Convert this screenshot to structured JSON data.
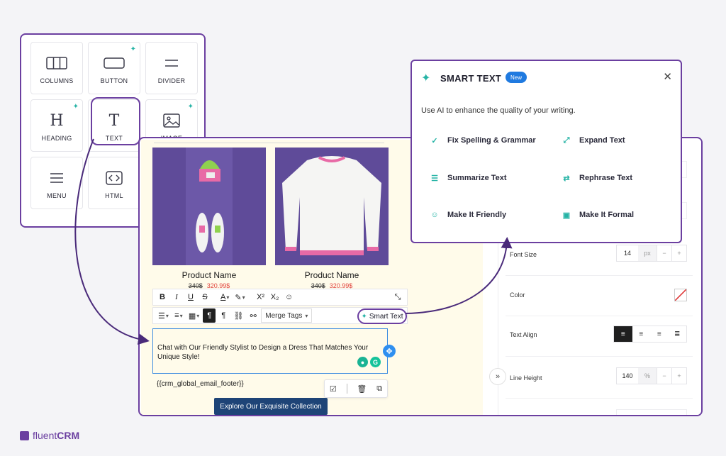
{
  "palette": {
    "tiles": [
      {
        "label": "COLUMNS",
        "icon": "columns-icon",
        "ai": false
      },
      {
        "label": "BUTTON",
        "icon": "button-icon",
        "ai": true
      },
      {
        "label": "DIVIDER",
        "icon": "divider-icon",
        "ai": false
      },
      {
        "label": "HEADING",
        "icon": "heading-icon",
        "ai": true
      },
      {
        "label": "TEXT",
        "icon": "text-icon",
        "ai": false
      },
      {
        "label": "IMAGE",
        "icon": "image-icon",
        "ai": true
      },
      {
        "label": "MENU",
        "icon": "menu-icon",
        "ai": false
      },
      {
        "label": "HTML",
        "icon": "html-icon",
        "ai": false
      }
    ]
  },
  "editor": {
    "products": [
      {
        "name": "Product Name",
        "old_price": "340$",
        "new_price": "320.99$"
      },
      {
        "name": "Product Name",
        "old_price": "340$",
        "new_price": "320.99$"
      }
    ],
    "toolbar": {
      "merge_tags": "Merge Tags",
      "smart_text": "Smart Text"
    },
    "text_content": "Chat with Our Friendly Stylist to Design a Dress That Matches Your Unique Style!",
    "footer_tag": "{{crm_global_email_footer}}",
    "cta": "Explore Our Exquisite Collection"
  },
  "settings": {
    "font_size_label": "Font Size",
    "font_size_value": "14",
    "font_size_unit": "px",
    "color_label": "Color",
    "text_align_label": "Text Align",
    "line_height_label": "Line Height",
    "line_height_value": "140",
    "line_height_unit": "%"
  },
  "smart_text_popup": {
    "title": "SMART TEXT",
    "badge": "New",
    "description": "Use AI to enhance the quality of your writing.",
    "options": [
      {
        "label": "Fix Spelling & Grammar",
        "icon": "spellcheck-icon"
      },
      {
        "label": "Expand Text",
        "icon": "expand-icon"
      },
      {
        "label": "Summarize Text",
        "icon": "list-icon"
      },
      {
        "label": "Rephrase Text",
        "icon": "shuffle-icon"
      },
      {
        "label": "Make It Friendly",
        "icon": "smile-icon"
      },
      {
        "label": "Make It Formal",
        "icon": "briefcase-icon"
      }
    ]
  },
  "brand": {
    "prefix": "fluent",
    "suffix": "CRM"
  },
  "colors": {
    "accent": "#6b3fa0",
    "ai": "#27b4a6",
    "cta": "#1e4477",
    "product_bg": "#5f4b99"
  }
}
